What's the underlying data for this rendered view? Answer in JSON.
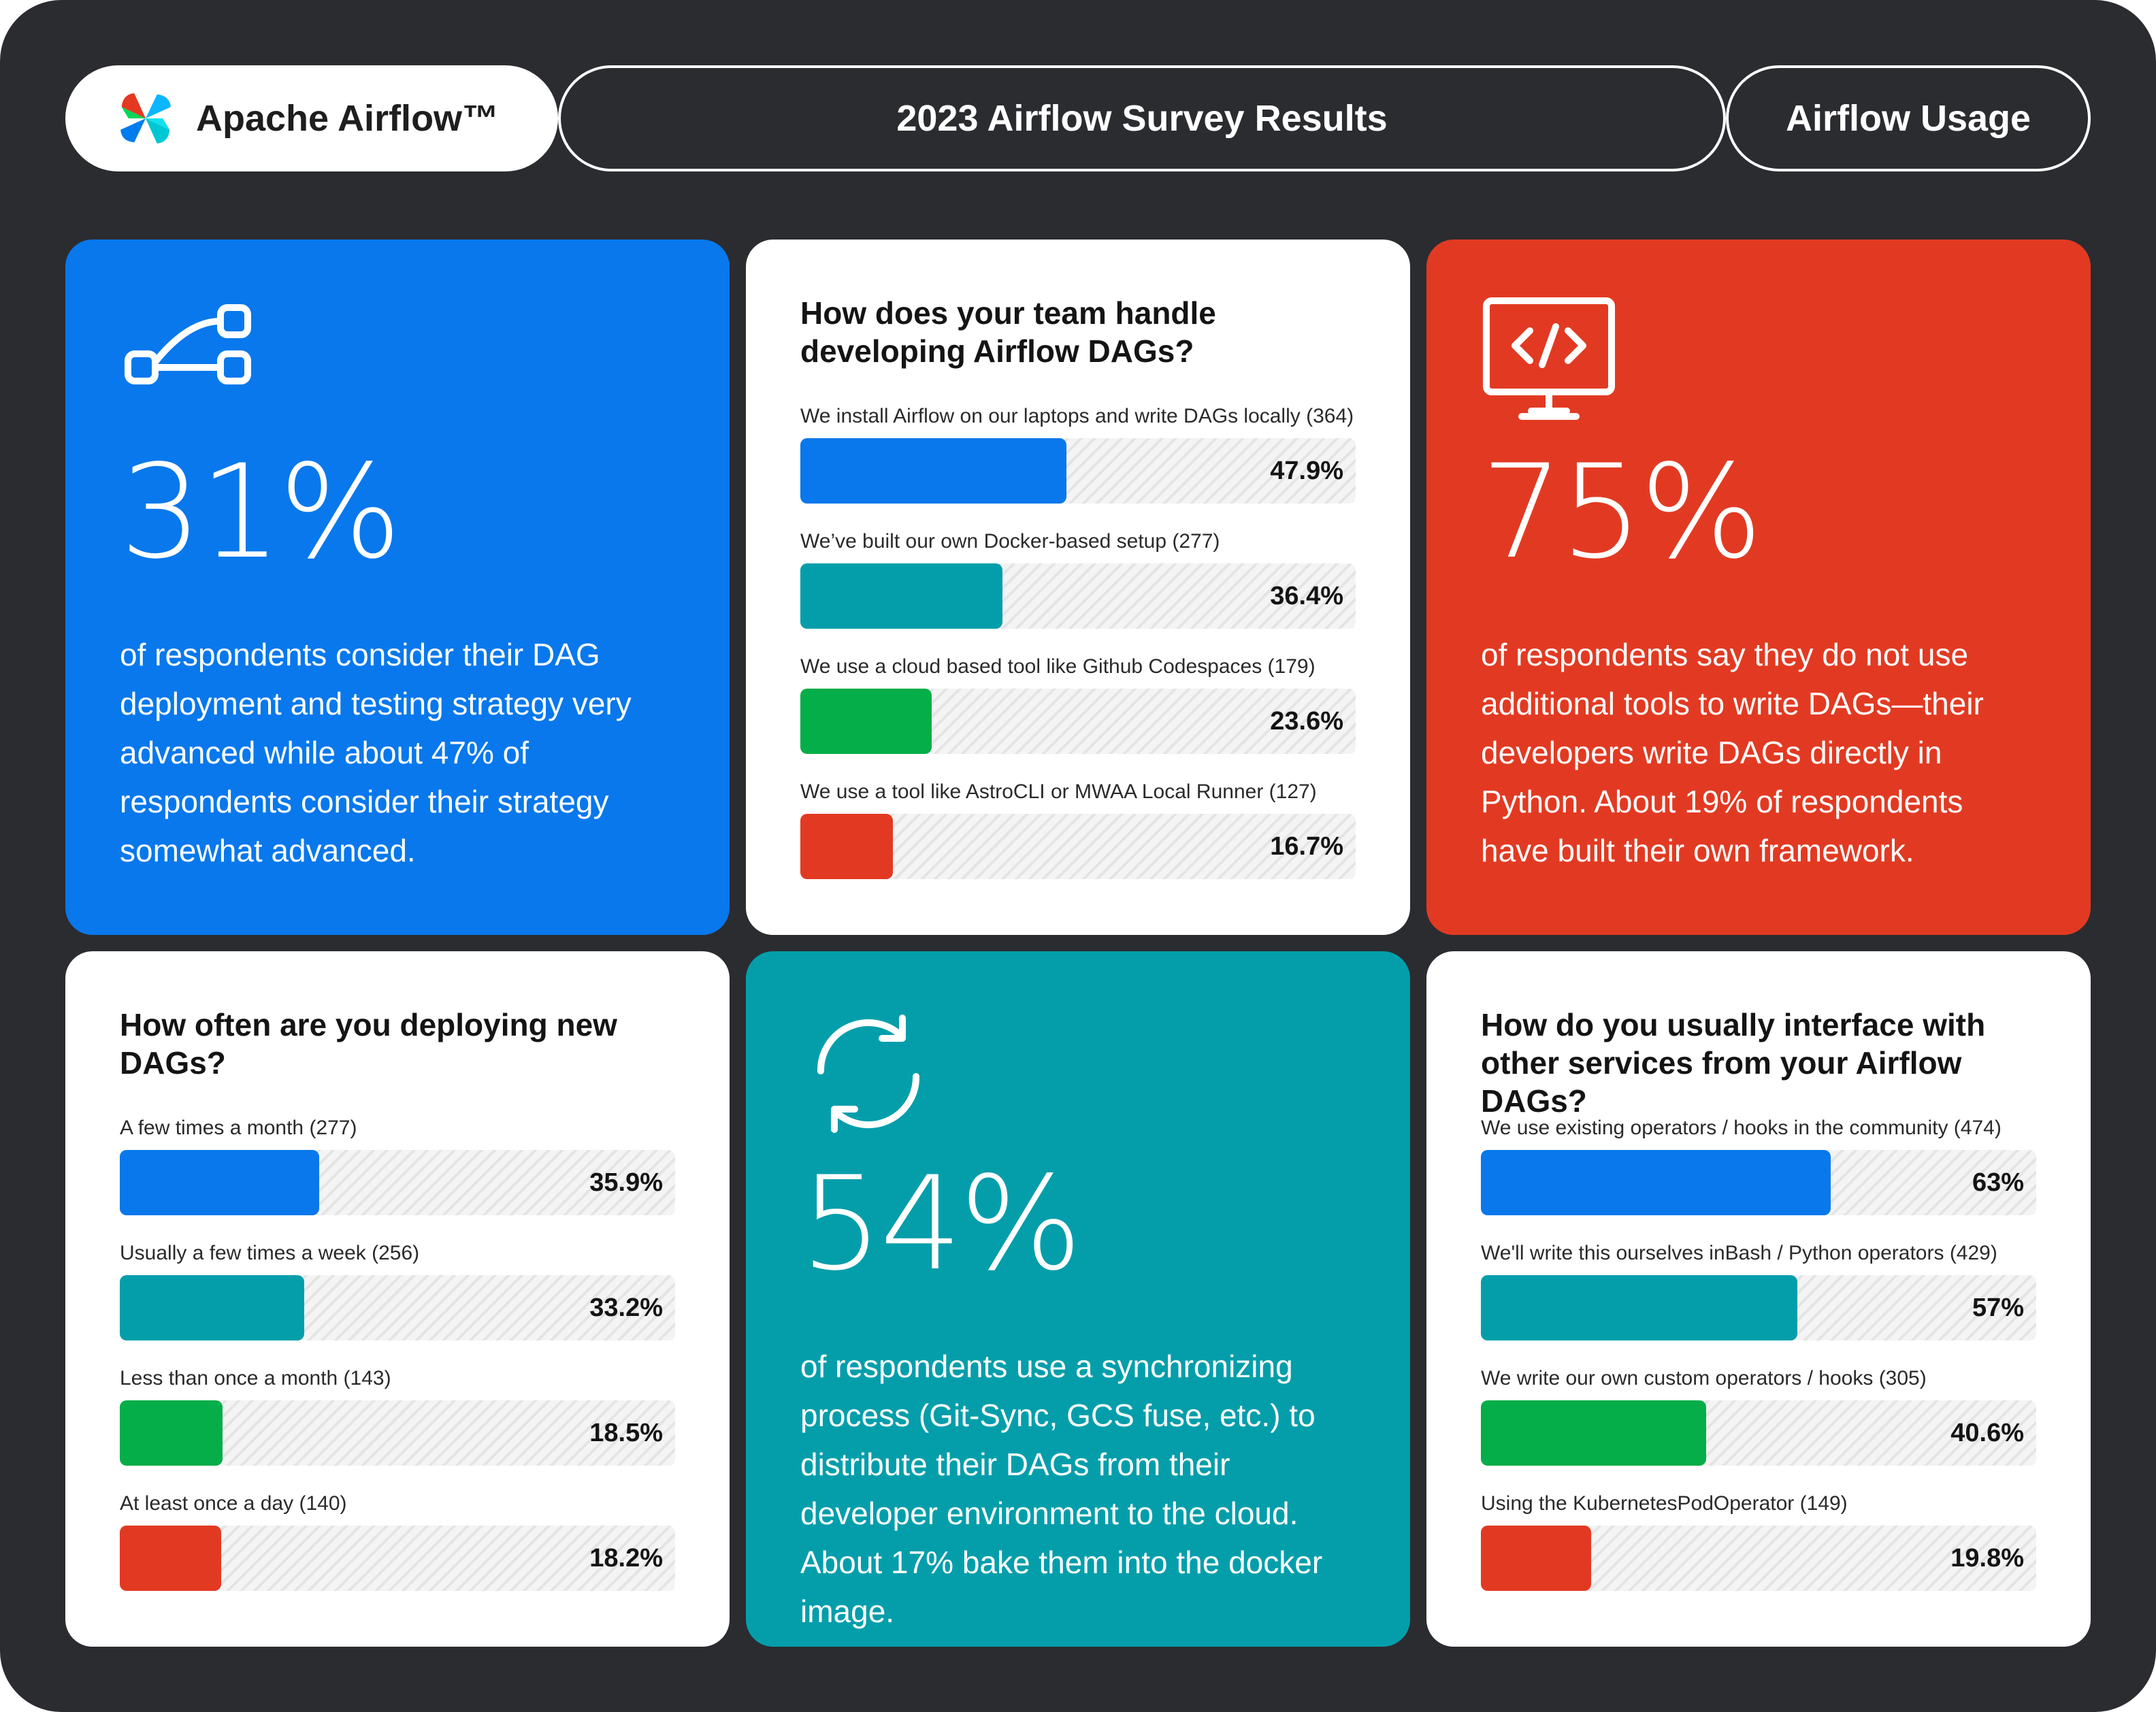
{
  "header": {
    "brand": "Apache Airflow™",
    "title": "2023 Airflow Survey Results",
    "section": "Airflow Usage"
  },
  "colors": {
    "frame": "#2b2c30",
    "blue": "#0878ec",
    "teal": "#049eab",
    "green": "#05ae48",
    "red": "#e23a22",
    "white": "#ffffff"
  },
  "stats": [
    {
      "icon": "dag-graph-icon",
      "value": "31%",
      "text": "of respondents consider their DAG deployment and testing strategy very advanced while about 47% of respondents consider their strategy somewhat advanced."
    },
    {
      "icon": "code-monitor-icon",
      "value": "75%",
      "text": "of respondents say they do not use additional tools to write DAGs—their developers write DAGs directly in Python. About 19% of respondents have built their own framework."
    },
    {
      "icon": "sync-arrows-icon",
      "value": "54%",
      "text": "of respondents use a synchronizing process (Git-Sync, GCS fuse, etc.) to distribute their DAGs from their developer environment to the cloud. About 17% bake them into the docker image."
    }
  ],
  "chart_data": [
    {
      "type": "bar",
      "orientation": "horizontal",
      "title": "How does your team handle developing Airflow DAGs?",
      "categories": [
        "We install Airflow on our laptops and write DAGs locally (364)",
        "We’ve built our own Docker-based setup (277)",
        "We use a cloud based tool like Github Codespaces (179)",
        "We use a tool like AstroCLI or MWAA Local Runner (127)"
      ],
      "values": [
        47.9,
        36.4,
        23.6,
        16.7
      ],
      "value_labels": [
        "47.9%",
        "36.4%",
        "23.6%",
        "16.7%"
      ],
      "colors": [
        "#0878ec",
        "#049eab",
        "#05ae48",
        "#e23a22"
      ],
      "xlim": [
        0,
        100
      ]
    },
    {
      "type": "bar",
      "orientation": "horizontal",
      "title": "How often are you deploying new DAGs?",
      "categories": [
        "A few times a month (277)",
        "Usually a few times a week (256)",
        "Less than once a month (143)",
        "At least once a day (140)"
      ],
      "values": [
        35.9,
        33.2,
        18.5,
        18.2
      ],
      "value_labels": [
        "35.9%",
        "33.2%",
        "18.5%",
        "18.2%"
      ],
      "colors": [
        "#0878ec",
        "#049eab",
        "#05ae48",
        "#e23a22"
      ],
      "xlim": [
        0,
        100
      ]
    },
    {
      "type": "bar",
      "orientation": "horizontal",
      "title": "How do you usually interface with other services from your Airflow DAGs?",
      "categories": [
        "We use existing operators / hooks in the community (474)",
        "We'll write this ourselves inBash / Python operators (429)",
        "We write our own custom operators / hooks (305)",
        "Using the KubernetesPodOperator (149)"
      ],
      "values": [
        63,
        57,
        40.6,
        19.8
      ],
      "value_labels": [
        "63%",
        "57%",
        "40.6%",
        "19.8%"
      ],
      "colors": [
        "#0878ec",
        "#049eab",
        "#05ae48",
        "#e23a22"
      ],
      "xlim": [
        0,
        100
      ]
    }
  ]
}
